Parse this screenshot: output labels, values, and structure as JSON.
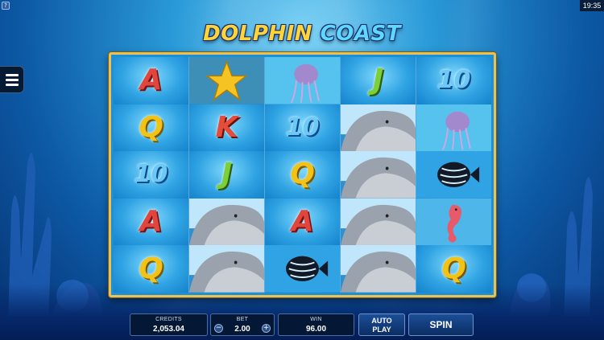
{
  "clock": "19:35",
  "help_icon": "?",
  "menu_icon": "hamburger-menu-icon",
  "logo": {
    "word1": "DOLPHIN",
    "word2": "COAST"
  },
  "reels": [
    [
      "A",
      "Q",
      "10",
      "A",
      "Q"
    ],
    [
      "starfish",
      "K",
      "J",
      "dolphin",
      "dolphin"
    ],
    [
      "jellyfish",
      "10",
      "Q",
      "A",
      "angelfish"
    ],
    [
      "J",
      "dolphin",
      "dolphin",
      "dolphin",
      "dolphin"
    ],
    [
      "10",
      "jellyfish",
      "angelfish",
      "seahorse",
      "Q"
    ]
  ],
  "hud": {
    "credits_label": "CREDITS",
    "credits_value": "2,053.04",
    "bet_label": "BET",
    "bet_value": "2.00",
    "bet_minus": "−",
    "bet_plus": "+",
    "win_label": "WIN",
    "win_value": "96.00",
    "autoplay_line1": "AUTO",
    "autoplay_line2": "PLAY",
    "spin_label": "SPIN"
  }
}
